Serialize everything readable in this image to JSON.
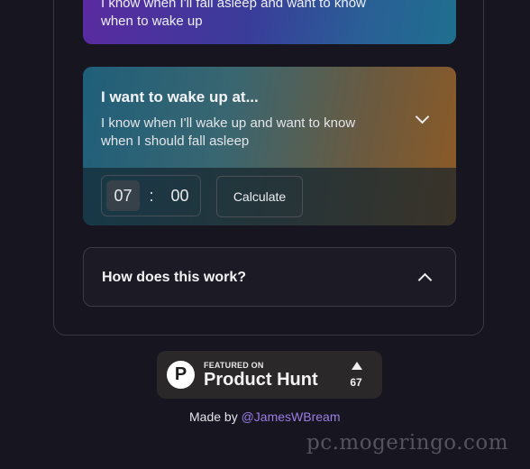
{
  "sleep_card": {
    "description": "I know when I'll fall asleep and want to know when to wake up"
  },
  "wake_card": {
    "title": "I want to wake up at...",
    "description": "I know when I'll wake up and want to know when I should fall asleep",
    "hour": "07",
    "separator": ":",
    "minute": "00",
    "calculate_label": "Calculate",
    "chevron_icon": "chevron-down-icon"
  },
  "how_card": {
    "title": "How does this work?",
    "chevron_icon": "chevron-up-icon"
  },
  "product_hunt": {
    "featured": "FEATURED ON",
    "name": "Product Hunt",
    "logo_letter": "P",
    "upvotes": "67"
  },
  "footer": {
    "made_by": "Made by ",
    "handle": "@JamesWBream"
  },
  "watermark": {
    "text": "pc.mogeringo.com"
  },
  "colors": {
    "background": "#17151f",
    "link": "#9a7ee6"
  }
}
